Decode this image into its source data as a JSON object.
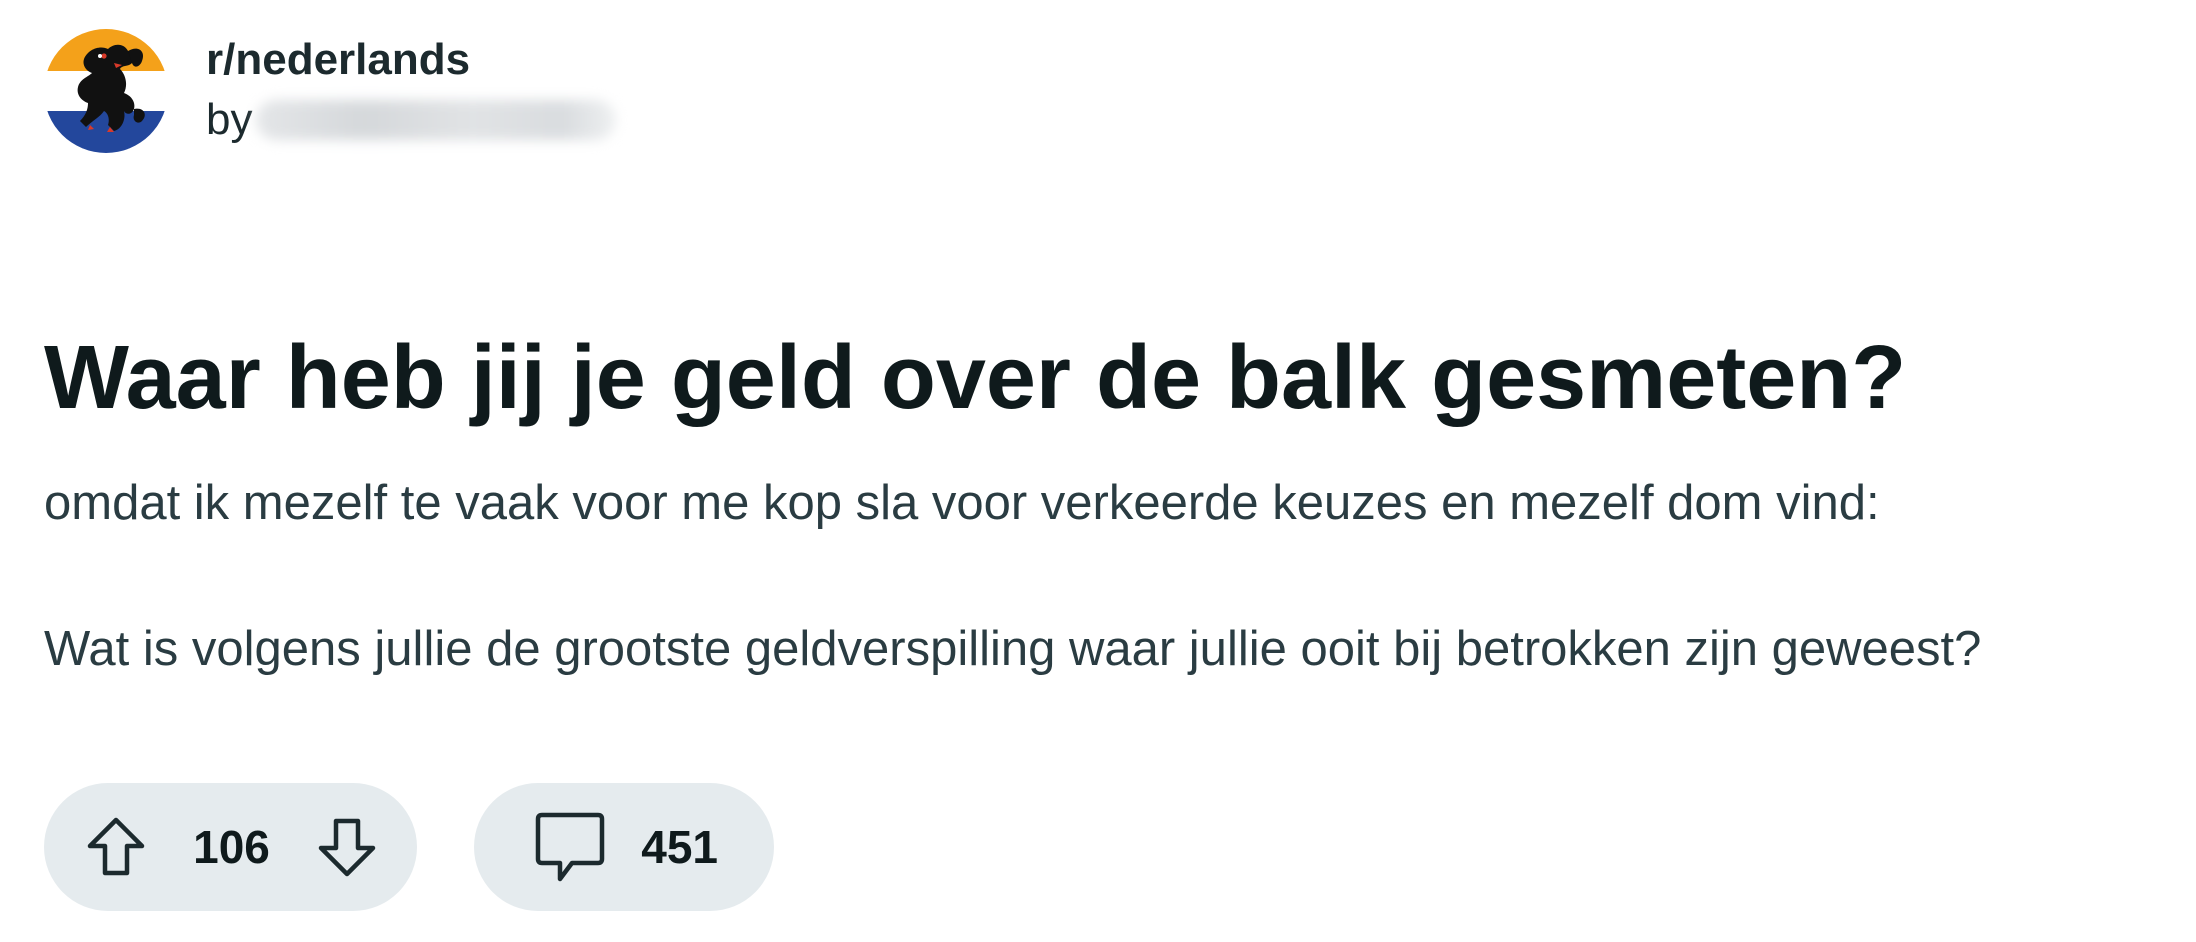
{
  "post": {
    "subreddit": "r/nederlands",
    "by_label": "by",
    "title": "Waar heb jij je geld over de balk gesmeten?",
    "body": [
      "omdat ik mezelf te vaak voor me kop sla voor verkeerde keuzes en mezelf dom vind:",
      "Wat is volgens jullie de grootste geldverspilling waar jullie ooit bij betrokken zijn geweest?"
    ]
  },
  "actions": {
    "score": "106",
    "comments": "451"
  },
  "icons": {
    "avatar": "flemish-lion-icon",
    "upvote": "arrow-up-icon",
    "downvote": "arrow-down-icon",
    "comment": "speech-bubble-icon"
  },
  "colors": {
    "avatar_top": "#f4a11a",
    "avatar_bottom": "#23479c",
    "pill_bg": "#e5ebee",
    "title_text": "#0f1a1c",
    "body_text": "#2a3c42"
  }
}
